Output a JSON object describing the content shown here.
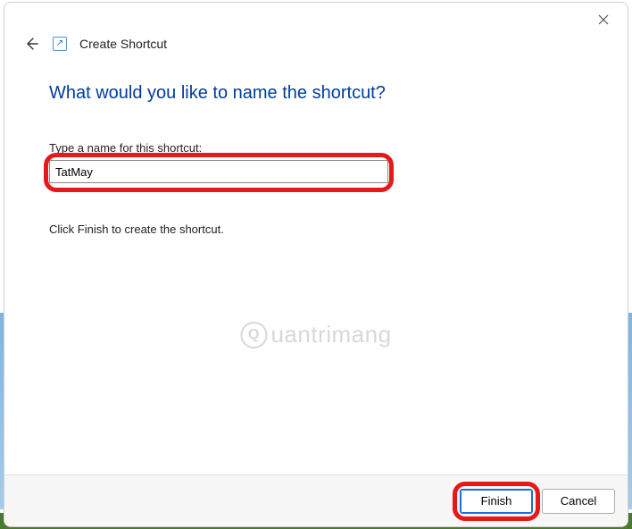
{
  "titlebar": {
    "close_tooltip": "Close"
  },
  "header": {
    "title": "Create Shortcut"
  },
  "main": {
    "heading": "What would you like to name the shortcut?",
    "field_label": "Type a name for this shortcut:",
    "shortcut_name": "TatMay",
    "instruction": "Click Finish to create the shortcut."
  },
  "watermark": {
    "text": "uantrimang"
  },
  "footer": {
    "finish_label": "Finish",
    "cancel_label": "Cancel"
  }
}
